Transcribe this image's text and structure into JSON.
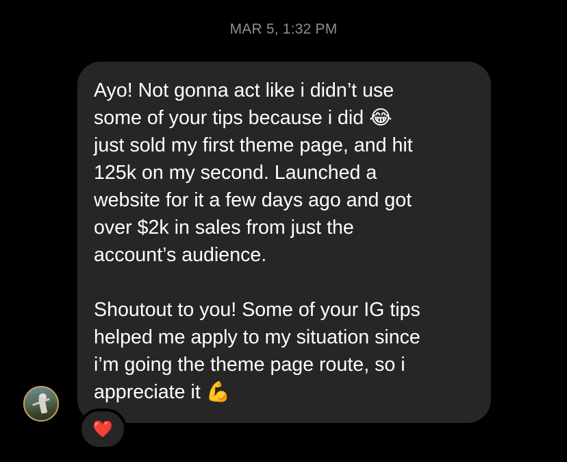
{
  "timestamp": "MAR 5, 1:32 PM",
  "message": {
    "paragraph1": "Ayo! Not gonna act like i didn’t use\nsome of your tips because i did 😂\njust sold my first theme page, and hit\n125k on my second. Launched a\nwebsite for it a few days ago and got\nover $2k in sales from just the\naccount’s audience.",
    "paragraph2": "Shoutout to you! Some of your IG tips\nhelped me apply to my situation since\ni’m going the theme page route, so i\nappreciate it 💪"
  },
  "reaction": {
    "emoji": "❤️"
  },
  "colors": {
    "background": "#000000",
    "bubble": "#262626",
    "timestamp": "#8e8e93",
    "text": "#ffffff"
  }
}
